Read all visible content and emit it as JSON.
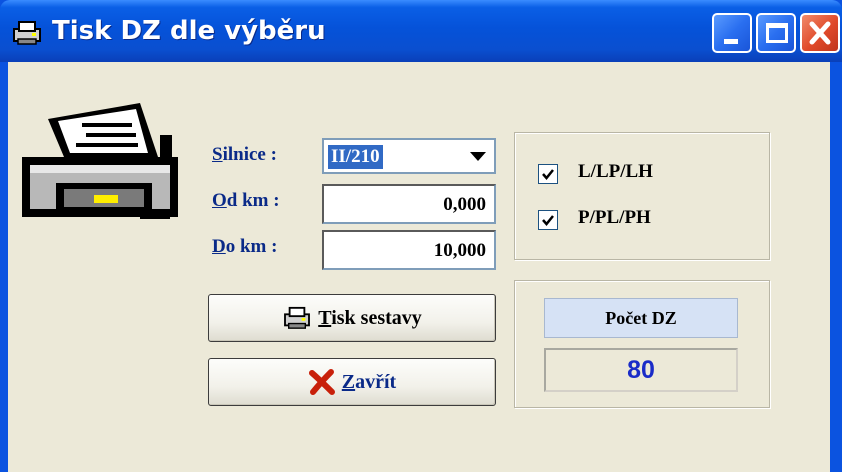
{
  "window": {
    "title": "Tisk DZ dle výběru",
    "controls": [
      "minimize-icon",
      "maximize-icon",
      "close-icon"
    ],
    "accent": "#0b53e0"
  },
  "form": {
    "silnice_label_u": "S",
    "silnice_label_rest": "ilnice :",
    "silnice_value": "II/210",
    "od_km_label_u": "O",
    "od_km_label_rest": "d km :",
    "od_km_value": "0,000",
    "do_km_label_u": "D",
    "do_km_label_rest": "o km :",
    "do_km_value": "10,000"
  },
  "options": {
    "items": [
      {
        "label": "L/LP/LH",
        "checked": true
      },
      {
        "label": "P/PL/PH",
        "checked": true
      }
    ]
  },
  "buttons": {
    "print_u": "T",
    "print_rest": "isk sestavy",
    "close_u": "Z",
    "close_rest": "avřít"
  },
  "count": {
    "label": "Počet DZ",
    "value": "80",
    "value_color": "#1a2cc8"
  }
}
